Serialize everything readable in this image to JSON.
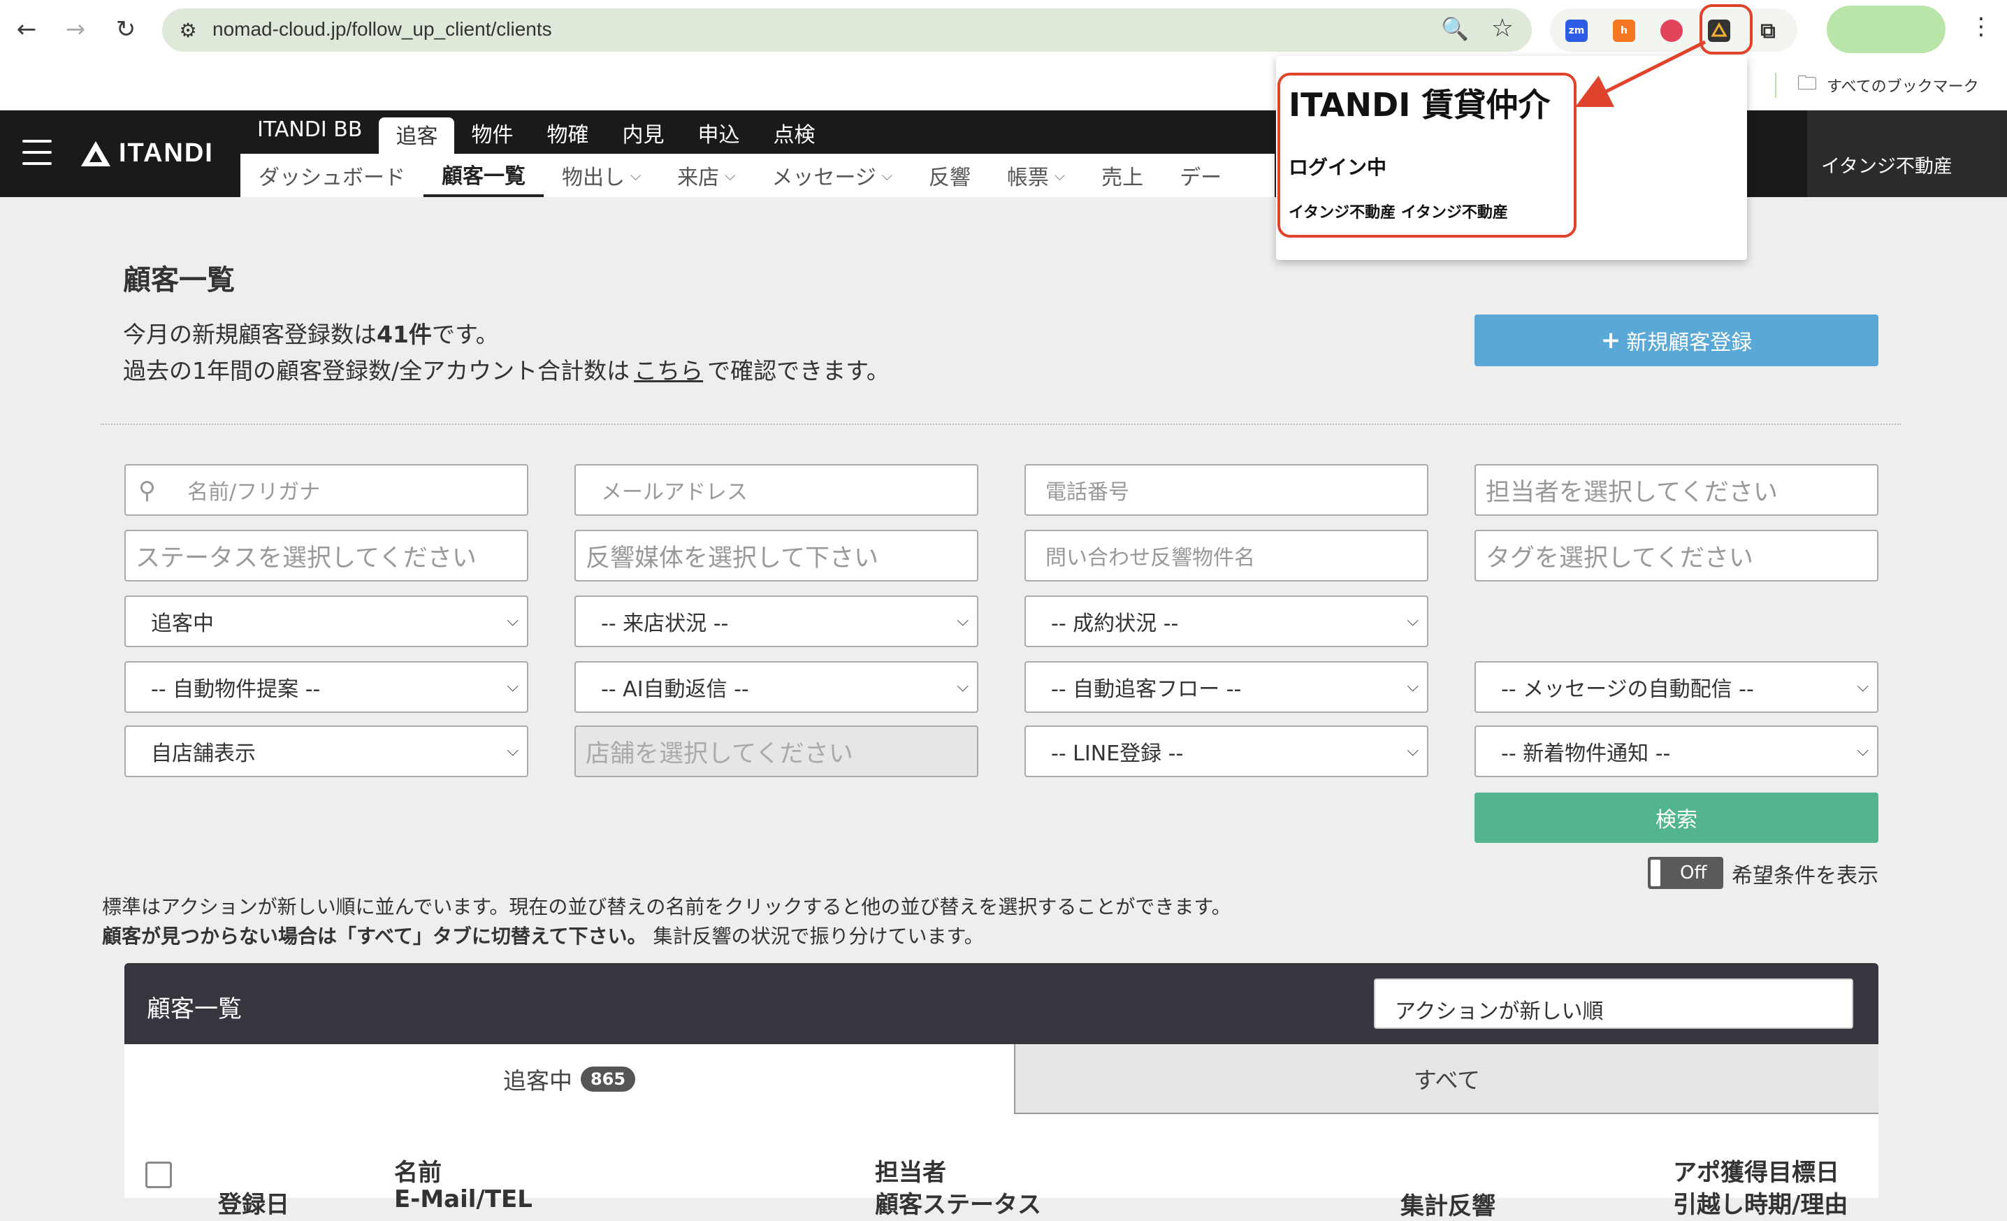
{
  "browser": {
    "url": "nomad-cloud.jp/follow_up_client/clients",
    "bookmarks_label": "すべてのブックマーク",
    "extensions": [
      {
        "name": "zoom-extension",
        "label": "zm",
        "color": "#2d5be3"
      },
      {
        "name": "hubspot-extension",
        "label": "h",
        "color": "#f57722"
      },
      {
        "name": "strawberry-extension",
        "label": "",
        "color": "#e0435a"
      },
      {
        "name": "itandi-extension",
        "label": "",
        "color": "#f2b134"
      }
    ]
  },
  "header": {
    "logo_text": "ITANDI",
    "top_nav": [
      "ITANDI BB",
      "追客",
      "物件",
      "物確",
      "内見",
      "申込",
      "点検"
    ],
    "sub_nav": [
      {
        "label": "ダッシュボード",
        "dropdown": false
      },
      {
        "label": "顧客一覧",
        "dropdown": false
      },
      {
        "label": "物出し",
        "dropdown": true
      },
      {
        "label": "来店",
        "dropdown": true
      },
      {
        "label": "メッセージ",
        "dropdown": true
      },
      {
        "label": "反響",
        "dropdown": false
      },
      {
        "label": "帳票",
        "dropdown": true
      },
      {
        "label": "売上",
        "dropdown": false
      },
      {
        "label": "デー",
        "dropdown": false
      }
    ],
    "account_name": "イタンジ不動産"
  },
  "page": {
    "title": "顧客一覧",
    "info_line1_pre": "今月の新規顧客登録数は",
    "info_line1_count": "41件",
    "info_line1_post": "です。",
    "info_line2_pre": "過去の1年間の顧客登録数/全アカウント合計数は",
    "info_line2_link": "こちら",
    "info_line2_post": "で確認できます。",
    "new_client_button": "新規顧客登録"
  },
  "filters": {
    "name_placeholder": "名前/フリガナ",
    "email_placeholder": "メールアドレス",
    "phone_placeholder": "電話番号",
    "staff_placeholder": "担当者を選択してください",
    "status_placeholder": "ステータスを選択してください",
    "media_placeholder": "反響媒体を選択して下さい",
    "inquiry_placeholder": "問い合わせ反響物件名",
    "tag_placeholder": "タグを選択してください",
    "follow_status": "追客中",
    "visit_status": "-- 来店状況 --",
    "contract_status": "-- 成約状況 --",
    "auto_property": "-- 自動物件提案 --",
    "ai_reply": "-- AI自動返信 --",
    "auto_flow": "-- 自動追客フロー --",
    "auto_message": "-- メッセージの自動配信 --",
    "store_display": "自店舗表示",
    "store_placeholder": "店舗を選択してください",
    "line_registration": "-- LINE登録 --",
    "new_arrival": "-- 新着物件通知 --",
    "search_button": "検索",
    "toggle_state": "Off",
    "toggle_label": "希望条件を表示"
  },
  "notes": {
    "line1": "標準はアクションが新しい順に並んでいます。現在の並び替えの名前をクリックすると他の並び替えを選択することができます。",
    "line2_bold": "顧客が見つからない場合は「すべて」タブに切替えて下さい。",
    "line2_rest": "集計反響の状況で振り分けています。"
  },
  "list": {
    "title": "顧客一覧",
    "sort": "アクションが新しい順",
    "tab_active": "追客中",
    "tab_active_count": "865",
    "tab_all": "すべて",
    "col_name": "名前",
    "col_staff": "担当者",
    "col_apo": "アポ獲得目標日",
    "col_date_partial": "登録日",
    "col_email_partial": "E-Mail/TEL",
    "col_status_partial": "顧客ステータス",
    "col_response_partial": "集計反響",
    "col_move_partial": "引越し時期/理由"
  },
  "popup": {
    "title": "ITANDI 賃貸仲介",
    "status": "ログイン中",
    "account": "イタンジ不動産 イタンジ不動産"
  }
}
